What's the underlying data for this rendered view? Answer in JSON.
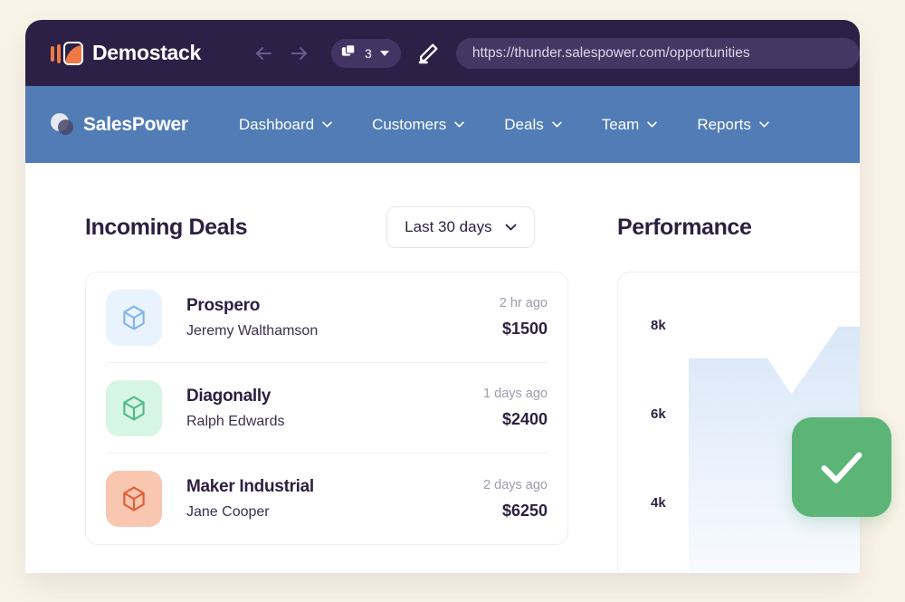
{
  "background_color": "#faf4e8",
  "browser_chrome": {
    "bg_color": "#2c2046",
    "brand_name": "Demostack",
    "back_icon": "arrow-left-icon",
    "forward_icon": "arrow-right-icon",
    "tab_count": "3",
    "tabs_icon": "stacked-windows-icon",
    "caret_icon": "caret-down-icon",
    "edit_icon": "pencil-icon",
    "url": "https://thunder.salespower.com/opportunities"
  },
  "app_nav": {
    "bg_color": "#517cb5",
    "brand_name": "SalesPower",
    "logo_icon": "two-circles-logo-icon",
    "items": [
      {
        "label": "Dashboard",
        "icon": "chevron-down-icon"
      },
      {
        "label": "Customers",
        "icon": "chevron-down-icon"
      },
      {
        "label": "Deals",
        "icon": "chevron-down-icon"
      },
      {
        "label": "Team",
        "icon": "chevron-down-icon"
      },
      {
        "label": "Reports",
        "icon": "chevron-down-icon"
      }
    ]
  },
  "deals_panel": {
    "title": "Incoming Deals",
    "range_filter": {
      "label": "Last 30 days",
      "icon": "chevron-down-icon"
    },
    "rows": [
      {
        "name": "Prospero",
        "person": "Jeremy Walthamson",
        "time": "2 hr ago",
        "amount": "$1500",
        "icon": "cube-icon",
        "icon_bg": "#e8f3fd",
        "icon_color": "#7fb4e8"
      },
      {
        "name": "Diagonally",
        "person": "Ralph Edwards",
        "time": "1 days ago",
        "amount": "$2400",
        "icon": "cube-icon",
        "icon_bg": "#d7f5e4",
        "icon_color": "#4cba84"
      },
      {
        "name": "Maker Industrial",
        "person": "Jane Cooper",
        "time": "2 days ago",
        "amount": "$6250",
        "icon": "cube-icon",
        "icon_bg": "#f9c6b0",
        "icon_color": "#e25c34"
      }
    ]
  },
  "performance_panel": {
    "title": "Performance",
    "chart": {
      "type": "area",
      "y_ticks": [
        "8k",
        "6k",
        "4k"
      ],
      "fill_top_color": "#dbe8f8",
      "fill_bottom_color": "#f7fafe"
    }
  },
  "status_badge": {
    "icon": "check-icon",
    "color": "#5cb577"
  },
  "chart_data": {
    "type": "area",
    "title": "Performance",
    "xlabel": "",
    "ylabel": "",
    "y_ticks": [
      "4k",
      "6k",
      "8k"
    ],
    "ylim": [
      3000,
      9000
    ],
    "grid": false,
    "legend": "none",
    "x": [
      0,
      1,
      2,
      3
    ],
    "values": [
      7300,
      7300,
      6150,
      7800
    ],
    "series": [
      {
        "name": "Performance",
        "values": [
          7300,
          7300,
          6150,
          7800
        ]
      }
    ]
  }
}
